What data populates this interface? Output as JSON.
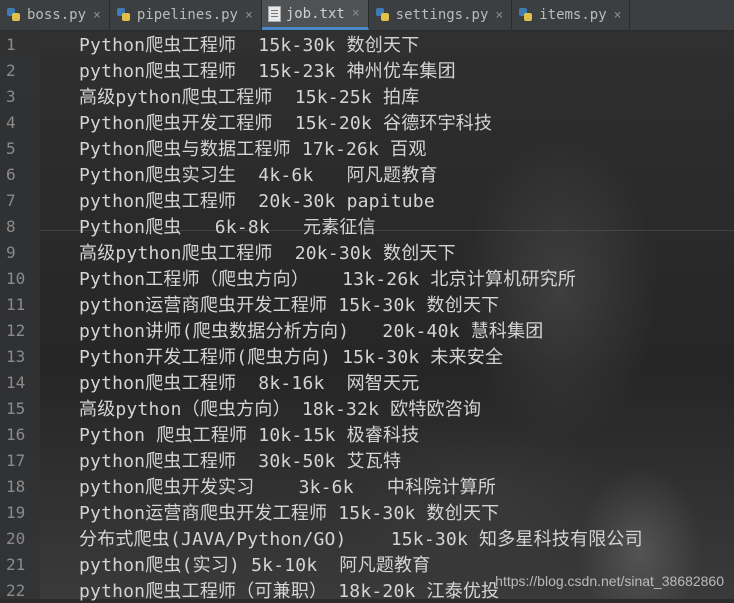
{
  "tabs": [
    {
      "label": "boss.py",
      "icon": "python-file-icon",
      "active": false
    },
    {
      "label": "pipelines.py",
      "icon": "python-file-icon",
      "active": false
    },
    {
      "label": "job.txt",
      "icon": "text-file-icon",
      "active": true
    },
    {
      "label": "settings.py",
      "icon": "python-file-icon",
      "active": false
    },
    {
      "label": "items.py",
      "icon": "python-file-icon",
      "active": false
    }
  ],
  "close_glyph": "×",
  "lines": [
    {
      "num": "1",
      "text": "Python爬虫工程师  15k-30k 数创天下"
    },
    {
      "num": "2",
      "text": "python爬虫工程师  15k-23k 神州优车集团"
    },
    {
      "num": "3",
      "text": "高级python爬虫工程师  15k-25k 拍库"
    },
    {
      "num": "4",
      "text": "Python爬虫开发工程师  15k-20k 谷德环宇科技"
    },
    {
      "num": "5",
      "text": "Python爬虫与数据工程师 17k-26k 百观"
    },
    {
      "num": "6",
      "text": "Python爬虫实习生  4k-6k   阿凡题教育"
    },
    {
      "num": "7",
      "text": "python爬虫工程师  20k-30k papitube"
    },
    {
      "num": "8",
      "text": "Python爬虫   6k-8k   元素征信"
    },
    {
      "num": "9",
      "text": "高级python爬虫工程师  20k-30k 数创天下"
    },
    {
      "num": "10",
      "text": "Python工程师（爬虫方向）   13k-26k 北京计算机研究所"
    },
    {
      "num": "11",
      "text": "python运营商爬虫开发工程师 15k-30k 数创天下"
    },
    {
      "num": "12",
      "text": "python讲师(爬虫数据分析方向)   20k-40k 慧科集团"
    },
    {
      "num": "13",
      "text": "Python开发工程师(爬虫方向) 15k-30k 未来安全"
    },
    {
      "num": "14",
      "text": "python爬虫工程师  8k-16k  网智天元"
    },
    {
      "num": "15",
      "text": "高级python（爬虫方向） 18k-32k 欧特欧咨询"
    },
    {
      "num": "16",
      "text": "Python 爬虫工程师 10k-15k 极睿科技"
    },
    {
      "num": "17",
      "text": "python爬虫工程师  30k-50k 艾瓦特"
    },
    {
      "num": "18",
      "text": "python爬虫开发实习    3k-6k   中科院计算所"
    },
    {
      "num": "19",
      "text": "Python运营商爬虫开发工程师 15k-30k 数创天下"
    },
    {
      "num": "20",
      "text": "分布式爬虫(JAVA/Python/GO)    15k-30k 知多星科技有限公司"
    },
    {
      "num": "21",
      "text": "python爬虫(实习) 5k-10k  阿凡题教育"
    },
    {
      "num": "22",
      "text": "python爬虫工程师（可兼职） 18k-20k 江泰优投"
    }
  ],
  "watermark": "https://blog.csdn.net/sinat_38682860"
}
